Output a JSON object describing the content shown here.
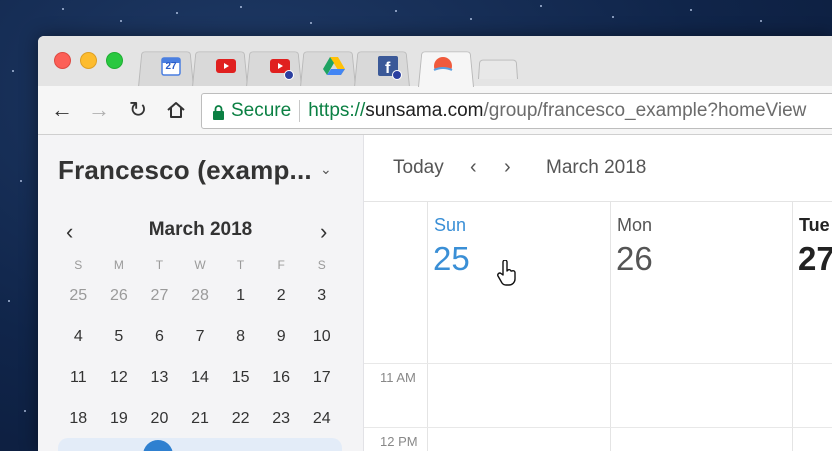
{
  "browser": {
    "tabs": [
      {
        "name": "calendar",
        "icon": "google-calendar-icon",
        "date": "27"
      },
      {
        "name": "youtube-1",
        "icon": "youtube-icon"
      },
      {
        "name": "youtube-2",
        "icon": "youtube-icon"
      },
      {
        "name": "drive",
        "icon": "google-drive-icon"
      },
      {
        "name": "facebook",
        "icon": "facebook-icon"
      },
      {
        "name": "sunsama",
        "icon": "sunsama-icon",
        "active": true
      }
    ],
    "secure_label": "Secure",
    "url": {
      "scheme": "https://",
      "host": "sunsama.com",
      "path": "/group/francesco_example?homeView"
    }
  },
  "sidebar": {
    "group_name": "Francesco (examp...",
    "mini_calendar": {
      "month_label": "March 2018",
      "weekday_headers": [
        "S",
        "M",
        "T",
        "W",
        "T",
        "F",
        "S"
      ],
      "weeks": [
        [
          "25",
          "26",
          "27",
          "28",
          "1",
          "2",
          "3"
        ],
        [
          "4",
          "5",
          "6",
          "7",
          "8",
          "9",
          "10"
        ],
        [
          "11",
          "12",
          "13",
          "14",
          "15",
          "16",
          "17"
        ],
        [
          "18",
          "19",
          "20",
          "21",
          "22",
          "23",
          "24"
        ]
      ],
      "muted_first_week_count": 4
    }
  },
  "calendar": {
    "today_label": "Today",
    "month_label": "March 2018",
    "days": [
      {
        "name": "Sun",
        "num": "25",
        "state": "current"
      },
      {
        "name": "Mon",
        "num": "26",
        "state": "normal"
      },
      {
        "name": "Tue",
        "num": "27",
        "state": "bold"
      }
    ],
    "hour_labels": [
      "11 AM",
      "12 PM"
    ]
  },
  "colors": {
    "accent_blue": "#3a8fd6",
    "secure_green": "#0b8043",
    "sidebar_bg": "#f4f4f6"
  }
}
